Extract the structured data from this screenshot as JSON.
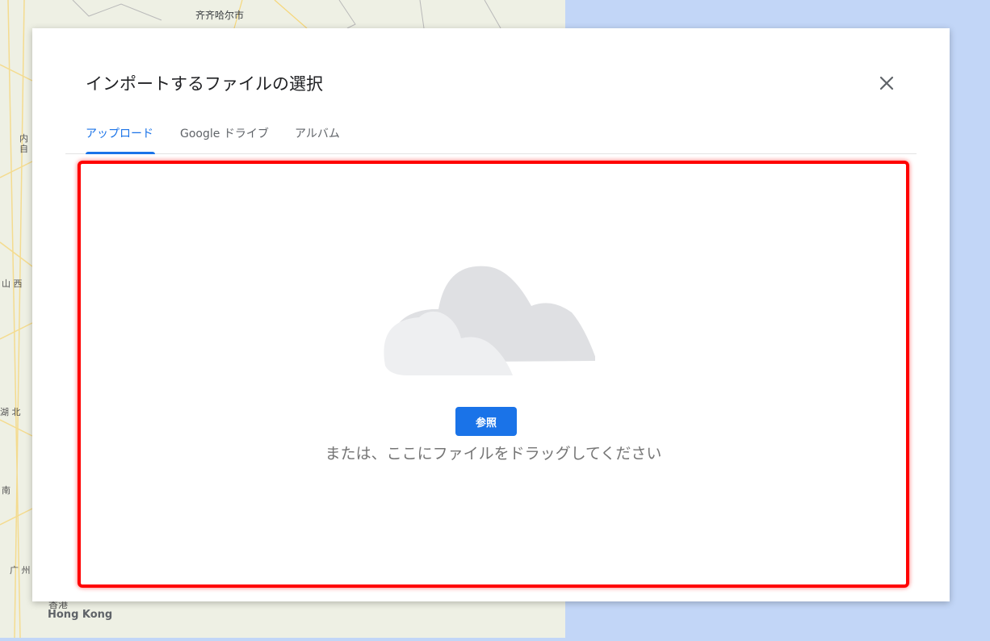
{
  "map": {
    "city_label": "齐齐哈尔市",
    "hongkong_cn": "香港",
    "hongkong_en": "Hong Kong",
    "side_labels": [
      "内",
      "自",
      "山 西",
      "湖 北",
      "南",
      "广 州"
    ]
  },
  "dialog": {
    "title": "インポートするファイルの選択",
    "tabs": [
      {
        "label": "アップロード"
      },
      {
        "label": "Google ドライブ"
      },
      {
        "label": "アルバム"
      }
    ],
    "upload": {
      "browse_label": "参照",
      "drag_hint": "または、ここにファイルをドラッグしてください"
    }
  },
  "colors": {
    "accent": "#1a73e8",
    "highlight_border": "#ff0000",
    "cloud_dark": "#dfe0e3",
    "cloud_light": "#eeeff1"
  },
  "icons": {
    "close": "close-icon",
    "illustration": "cloud-icon"
  }
}
